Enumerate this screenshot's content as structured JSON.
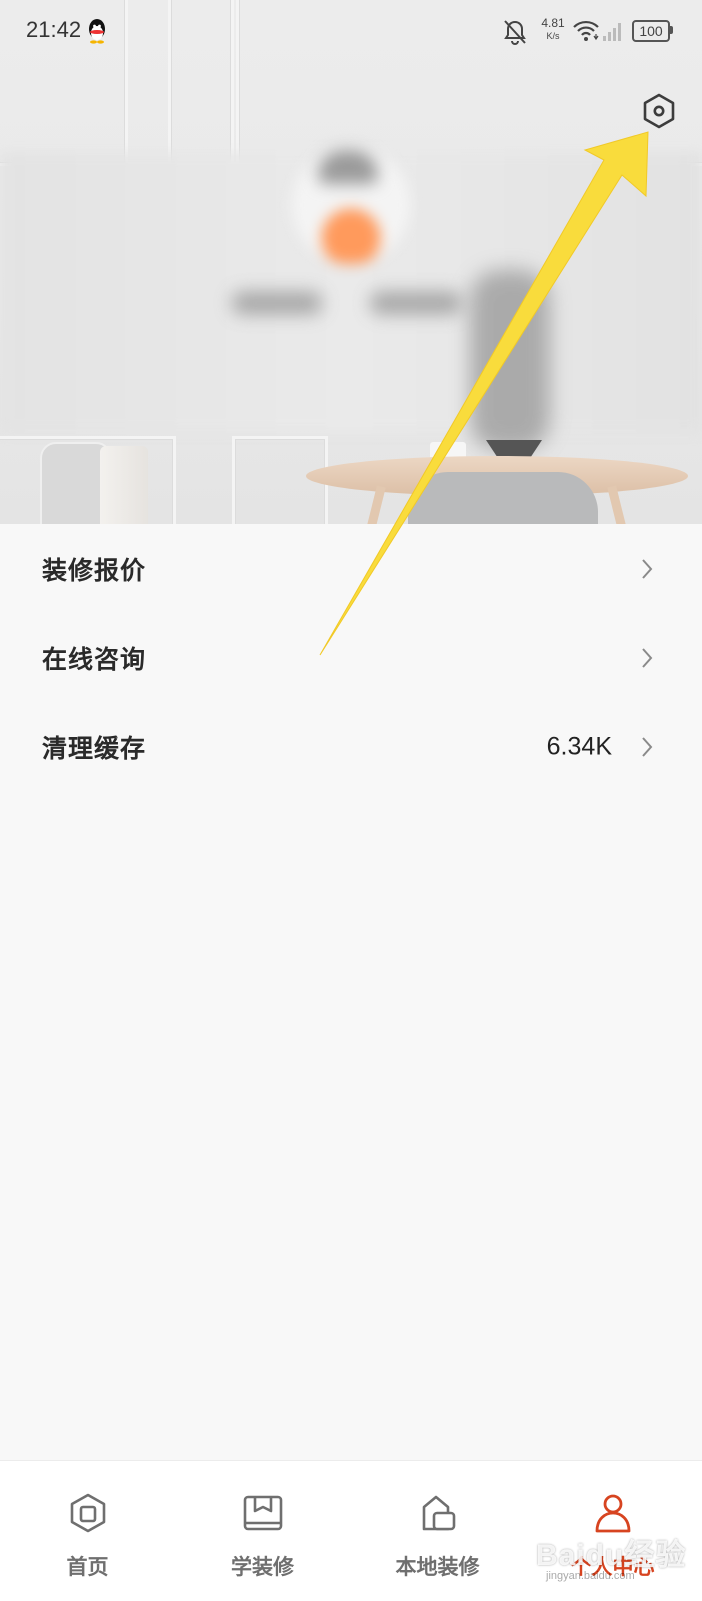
{
  "status_bar": {
    "time": "21:42",
    "net_speed_value": "4.81",
    "net_speed_unit": "K/s",
    "battery": "100",
    "icons": [
      "qq-icon",
      "bell-off-icon",
      "wifi-icon",
      "signal-icon",
      "battery-icon"
    ]
  },
  "header": {
    "settings_icon": "gear-hexagon-icon",
    "annotation_color": "#f9dc3c"
  },
  "menu": {
    "items": [
      {
        "label": "装修报价",
        "value": ""
      },
      {
        "label": "在线咨询",
        "value": ""
      },
      {
        "label": "清理缓存",
        "value": "6.34K"
      }
    ]
  },
  "bottom_nav": {
    "items": [
      {
        "label": "首页",
        "icon": "home-icon",
        "active": false
      },
      {
        "label": "学装修",
        "icon": "book-icon",
        "active": false
      },
      {
        "label": "本地装修",
        "icon": "local-icon",
        "active": false
      },
      {
        "label": "个人中心",
        "icon": "person-icon",
        "active": true
      }
    ],
    "active_color": "#d74420",
    "inactive_color": "#6f6f6f"
  },
  "watermark": {
    "brand": "Baidu经验",
    "url": "jingyan.baidu.com"
  }
}
